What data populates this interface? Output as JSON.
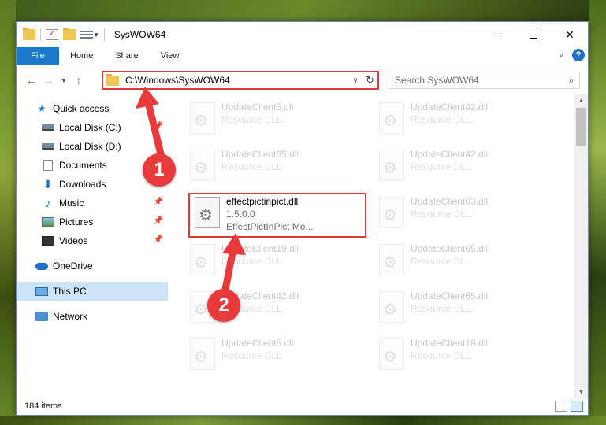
{
  "window": {
    "title": "SysWOW64"
  },
  "ribbon": {
    "tabs": [
      {
        "label": "File"
      },
      {
        "label": "Home"
      },
      {
        "label": "Share"
      },
      {
        "label": "View"
      }
    ],
    "help_label": "?"
  },
  "address": {
    "path": "C:\\Windows\\SysWOW64"
  },
  "search": {
    "placeholder": "Search SysWOW64"
  },
  "sidebar": {
    "quick_access": "Quick access",
    "items": [
      {
        "label": "Local Disk (C:)",
        "pinned": true
      },
      {
        "label": "Local Disk (D:)",
        "pinned": true
      },
      {
        "label": "Documents",
        "pinned": true
      },
      {
        "label": "Downloads",
        "pinned": true
      },
      {
        "label": "Music",
        "pinned": true
      },
      {
        "label": "Pictures",
        "pinned": true
      },
      {
        "label": "Videos",
        "pinned": true
      }
    ],
    "onedrive": "OneDrive",
    "this_pc": "This PC",
    "network": "Network"
  },
  "files": {
    "left": [
      {
        "name": "UpdateClient5.dll",
        "sub": "Resource DLL"
      },
      {
        "name": "UpdateClient65.dll",
        "sub": "Resource DLL"
      },
      {
        "name": "effectpictinpict.dll",
        "sub": "1.5.0.0",
        "sub2": "EffectPictInPict Mo..."
      },
      {
        "name": "UpdateClient19.dll",
        "sub": "Resource DLL"
      },
      {
        "name": "UpdateClient42.dll",
        "sub": "Resource DLL"
      },
      {
        "name": "UpdateClient5.dll",
        "sub": "Resource DLL"
      }
    ],
    "right": [
      {
        "name": "UpdateClient42.dll",
        "sub": "Resource DLL"
      },
      {
        "name": "UpdateClient42.dll",
        "sub": "Resource DLL"
      },
      {
        "name": "UpdateClient63.dll",
        "sub": "Resource DLL"
      },
      {
        "name": "UpdateClient65.dll",
        "sub": "Resource DLL"
      },
      {
        "name": "UpdateClient65.dll",
        "sub": "Resource DLL"
      },
      {
        "name": "UpdateClient19.dll",
        "sub": "Resource DLL"
      }
    ]
  },
  "status": {
    "item_count": "184 items"
  },
  "annotations": {
    "badge1": "1",
    "badge2": "2",
    "color": "#e8393b"
  }
}
